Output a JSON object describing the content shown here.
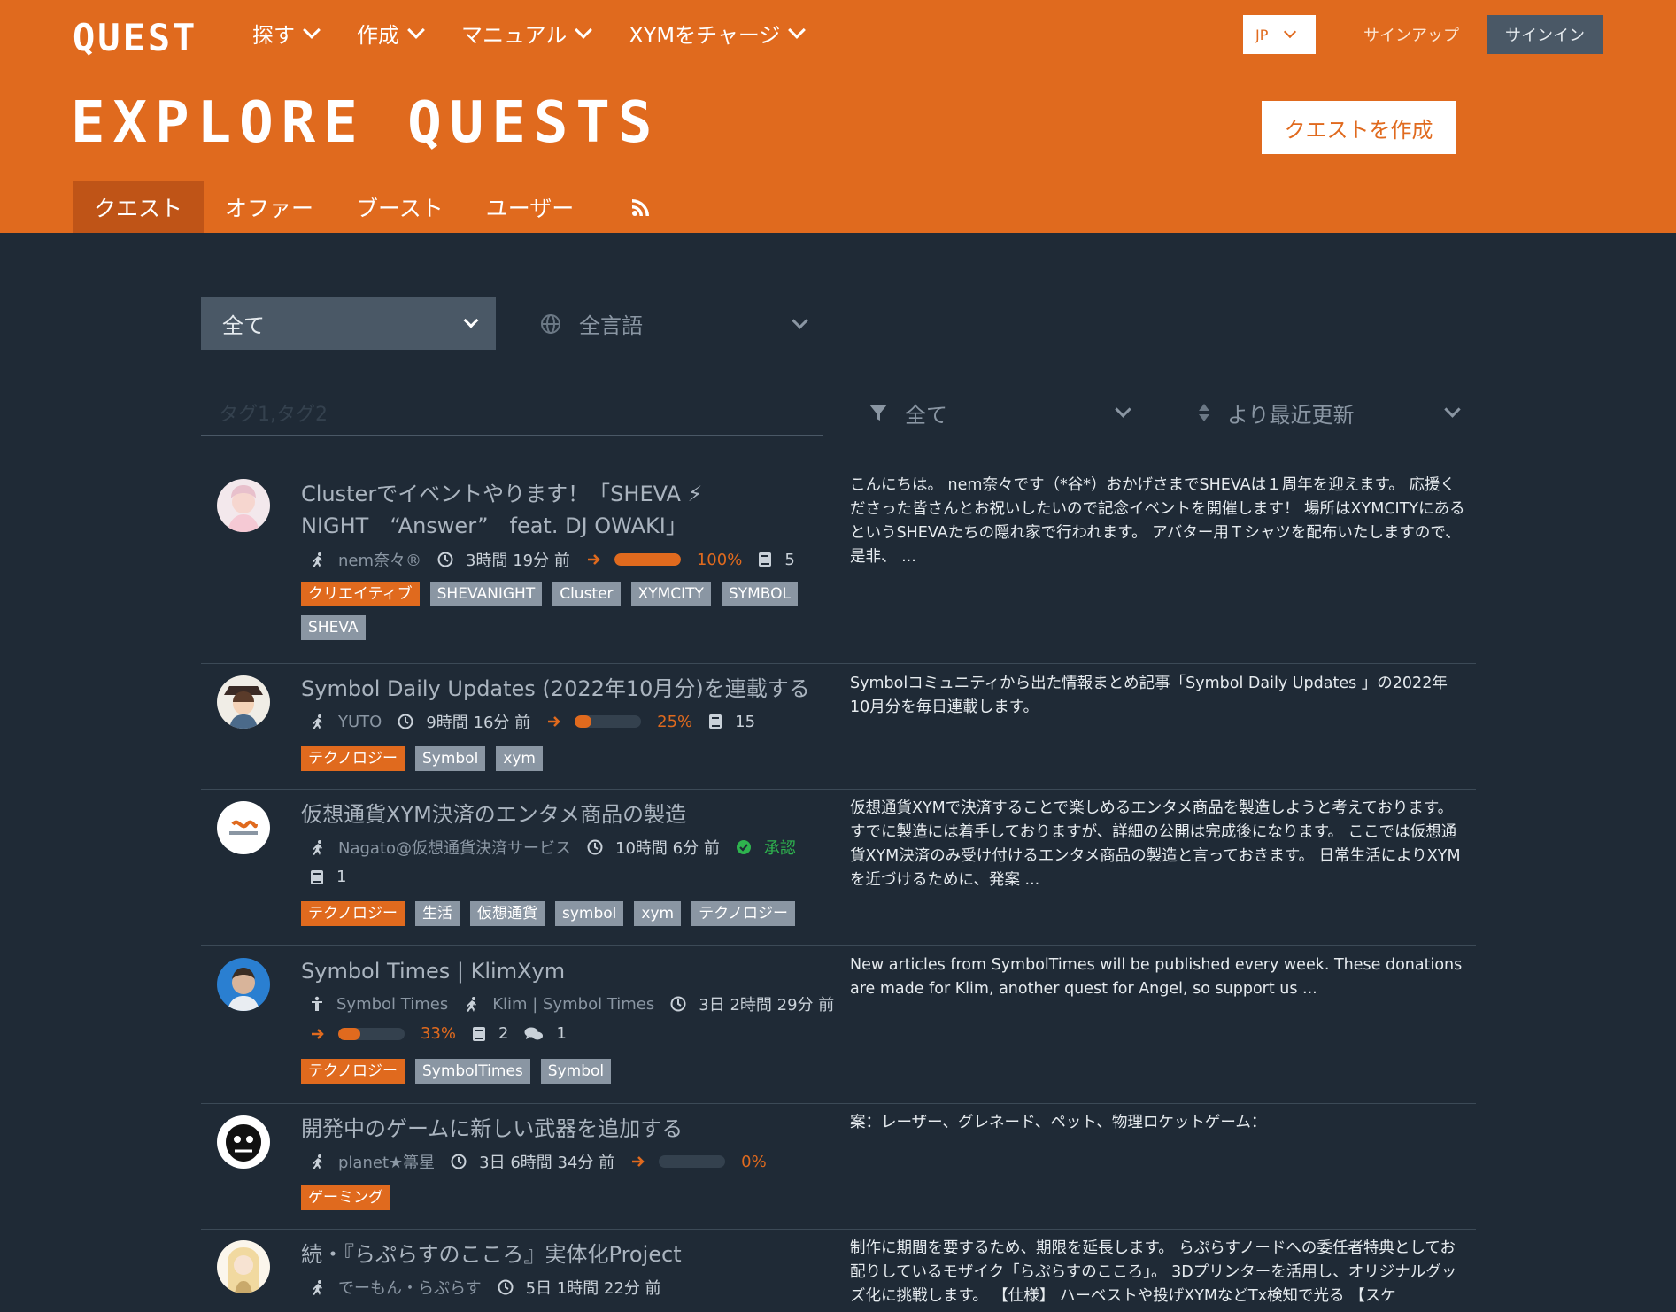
{
  "header": {
    "logo": "QUEST",
    "nav": [
      {
        "label": "探す"
      },
      {
        "label": "作成"
      },
      {
        "label": "マニュアル"
      },
      {
        "label": "XYMをチャージ"
      }
    ],
    "language": "JP",
    "signup": "サインアップ",
    "signin": "サインイン",
    "page_title": "EXPLORE QUESTS",
    "create_button": "クエストを作成",
    "tabs": [
      {
        "label": "クエスト",
        "active": true
      },
      {
        "label": "オファー"
      },
      {
        "label": "ブースト"
      },
      {
        "label": "ユーザー"
      }
    ]
  },
  "filters": {
    "category": "全て",
    "language": "全言語",
    "tags_placeholder": "タグ1,タグ2",
    "status": "全て",
    "sort": "より最近更新"
  },
  "quests": [
    {
      "title": "Clusterでイベントやります！「SHEVA ⚡ NIGHT　“Answer”　feat. DJ OWAKI」",
      "author": "nem奈々®",
      "time": "3時間 19分 前",
      "progress": 100,
      "progress_label": "100%",
      "book_count": "5",
      "tags": [
        "クリエイティブ",
        "SHEVANIGHT",
        "Cluster",
        "XYMCITY",
        "SYMBOL",
        "SHEVA"
      ],
      "description": "こんにちは。 nem奈々です（*谷*）おかげさまでSHEVAは１周年を迎えます。 応援くださった皆さんとお祝いしたいので記念イベントを開催します！ 場所はXYMCITYにあるというSHEVAたちの隠れ家で行われます。 アバター用Ｔシャツを配布いたしますので、 是非、 ..."
    },
    {
      "title": "Symbol Daily Updates (2022年10月分)を連載する",
      "author": "YUTO",
      "time": "9時間 16分 前",
      "progress": 25,
      "progress_label": "25%",
      "book_count": "15",
      "tags": [
        "テクノロジー",
        "Symbol",
        "xym"
      ],
      "description": "Symbolコミュニティから出た情報まとめ記事「Symbol Daily Updates 」の2022年10月分を毎日連載します。"
    },
    {
      "title": "仮想通貨XYM決済のエンタメ商品の製造",
      "author": "Nagato@仮想通貨決済サービス",
      "time": "10時間 6分 前",
      "status": "承認",
      "book_count": "1",
      "tags": [
        "テクノロジー",
        "生活",
        "仮想通貨",
        "symbol",
        "xym",
        "テクノロジー"
      ],
      "description": "仮想通貨XYMで決済することで楽しめるエンタメ商品を製造しようと考えております。 すでに製造には着手しておりますが、詳細の公開は完成後になります。 ここでは仮想通貨XYM決済のみ受け付けるエンタメ商品の製造と言っておきます。 日常生活によりXYMを近づけるために、発案 ..."
    },
    {
      "title": "Symbol Times | KlimXym",
      "group": "Symbol Times",
      "author": "Klim | Symbol Times",
      "time": "3日 2時間 29分 前",
      "progress": 33,
      "progress_label": "33%",
      "book_count": "2",
      "comment_count": "1",
      "tags": [
        "テクノロジー",
        "SymbolTimes",
        "Symbol"
      ],
      "description": "New articles from SymbolTimes will be published every week. These donations are made for Klim, another quest for Angel, so support us ..."
    },
    {
      "title": "開発中のゲームに新しい武器を追加する",
      "author": "planet★箒星",
      "time": "3日 6時間 34分 前",
      "progress": 0,
      "progress_label": "0%",
      "tags": [
        "ゲーミング"
      ],
      "description": "案：レーザー、グレネード、ペット、物理ロケットゲーム："
    },
    {
      "title": "続・『らぷらすのこころ』実体化Project",
      "author": "でーもん・らぷらす",
      "time": "5日 1時間 22分 前",
      "tags": [],
      "description": "制作に期間を要するため、期限を延長します。 らぷらすノードへの委任者特典としてお配りしているモザイク「らぷらすのこころ」。 3Dプリンターを活用し、オリジナルグッズ化に挑戦します。 【仕様】 ハーベストや投げXYMなどTx検知で光る 【スケ"
    }
  ],
  "colors": {
    "accent": "#e06a1e",
    "background": "#1f2a36",
    "tag_gray": "#8a96a3",
    "status_green": "#2eb34e"
  }
}
